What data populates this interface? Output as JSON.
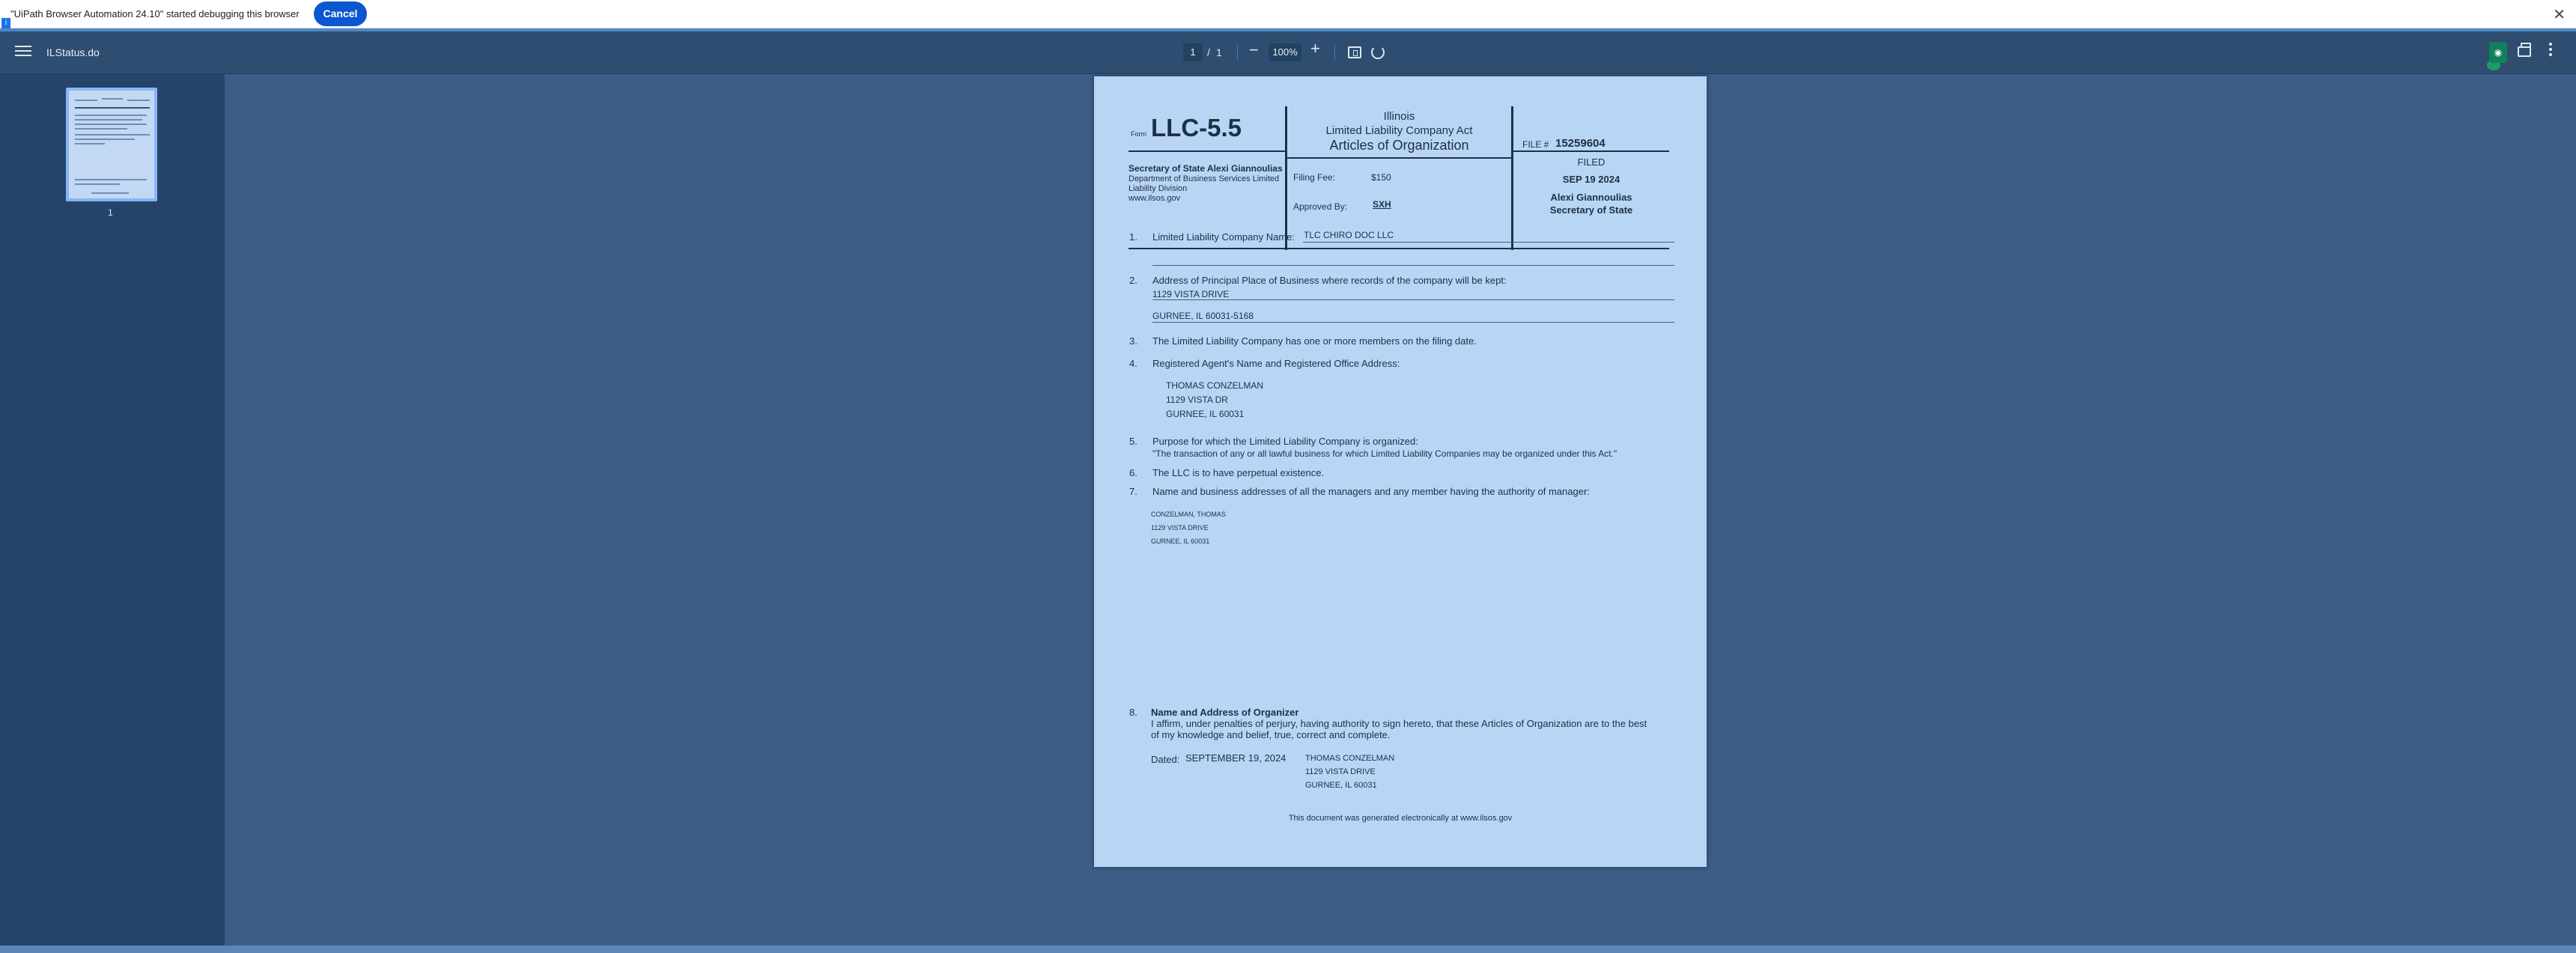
{
  "debug_banner": {
    "message": "\"UiPath Browser Automation 24.10\" started debugging this browser",
    "cancel_label": "Cancel",
    "close_glyph": "✕",
    "badge_glyph": "i"
  },
  "toolbar": {
    "title": "ILStatus.do",
    "current_page": "1",
    "separator": "/",
    "total_pages": "1",
    "zoom": "100%",
    "zoom_out_glyph": "−",
    "zoom_in_glyph": "+",
    "extension_glyph": "◉"
  },
  "sidebar": {
    "thumbnail_label": "1"
  },
  "document": {
    "header": {
      "form_prefix": "Form",
      "form_number": "LLC-5.5",
      "state": "Illinois",
      "act": "Limited Liability Company Act",
      "doc_title": "Articles of Organization",
      "file_label": "FILE #",
      "file_number": "15259604",
      "secretary_line": "Secretary of State Alexi Giannoulias",
      "dept_line1": "Department of Business Services Limited",
      "dept_line2": "Liability Division",
      "website": "www.ilsos.gov",
      "filing_fee_label": "Filing Fee:",
      "filing_fee_value": "$150",
      "approved_by_label": "Approved By:",
      "approved_by_value": "SXH",
      "filed_label": "FILED",
      "filed_date": "SEP 19 2024",
      "signer_name": "Alexi Giannoulias",
      "signer_title": "Secretary of State"
    },
    "items": {
      "n1": "1.",
      "item1_label": "Limited Liability Company Name:",
      "item1_value": "TLC CHIRO DOC LLC",
      "n2": "2.",
      "item2_label": "Address of Principal Place of Business where records of the company will be kept:",
      "item2_line1": "1129 VISTA DRIVE",
      "item2_line2": "GURNEE, IL 60031-5168",
      "n3": "3.",
      "item3_text": "The Limited Liability Company has one or more members on the filing date.",
      "n4": "4.",
      "item4_label": "Registered Agent's Name and Registered Office Address:",
      "agent_name": "THOMAS CONZELMAN",
      "agent_street": "1129 VISTA DR",
      "agent_city": "GURNEE, IL 60031",
      "n5": "5.",
      "item5_label": "Purpose for which the Limited Liability Company is organized:",
      "item5_text": "\"The transaction of any or all lawful business for which Limited Liability Companies may be organized under this Act.\"",
      "n6": "6.",
      "item6_text": "The LLC is to have perpetual existence.",
      "n7": "7.",
      "item7_label": "Name and business addresses of all the managers and any member having the authority of manager:",
      "manager_name": "CONZELMAN, THOMAS",
      "manager_street": "1129 VISTA DRIVE",
      "manager_city": "GURNEE, IL 60031",
      "n8": "8.",
      "item8_label": "Name and Address of Organizer",
      "item8_text1": "I affirm, under penalties of perjury, having authority to sign hereto, that these Articles of Organization are to the best",
      "item8_text2": "of my knowledge and belief, true, correct and complete.",
      "dated_label": "Dated:",
      "dated_value": "SEPTEMBER 19, 2024",
      "organizer_name": "THOMAS CONZELMAN",
      "organizer_street": "1129 VISTA DRIVE",
      "organizer_city": "GURNEE, IL 60031"
    },
    "footer": "This document was generated electronically at www.ilsos.gov"
  }
}
